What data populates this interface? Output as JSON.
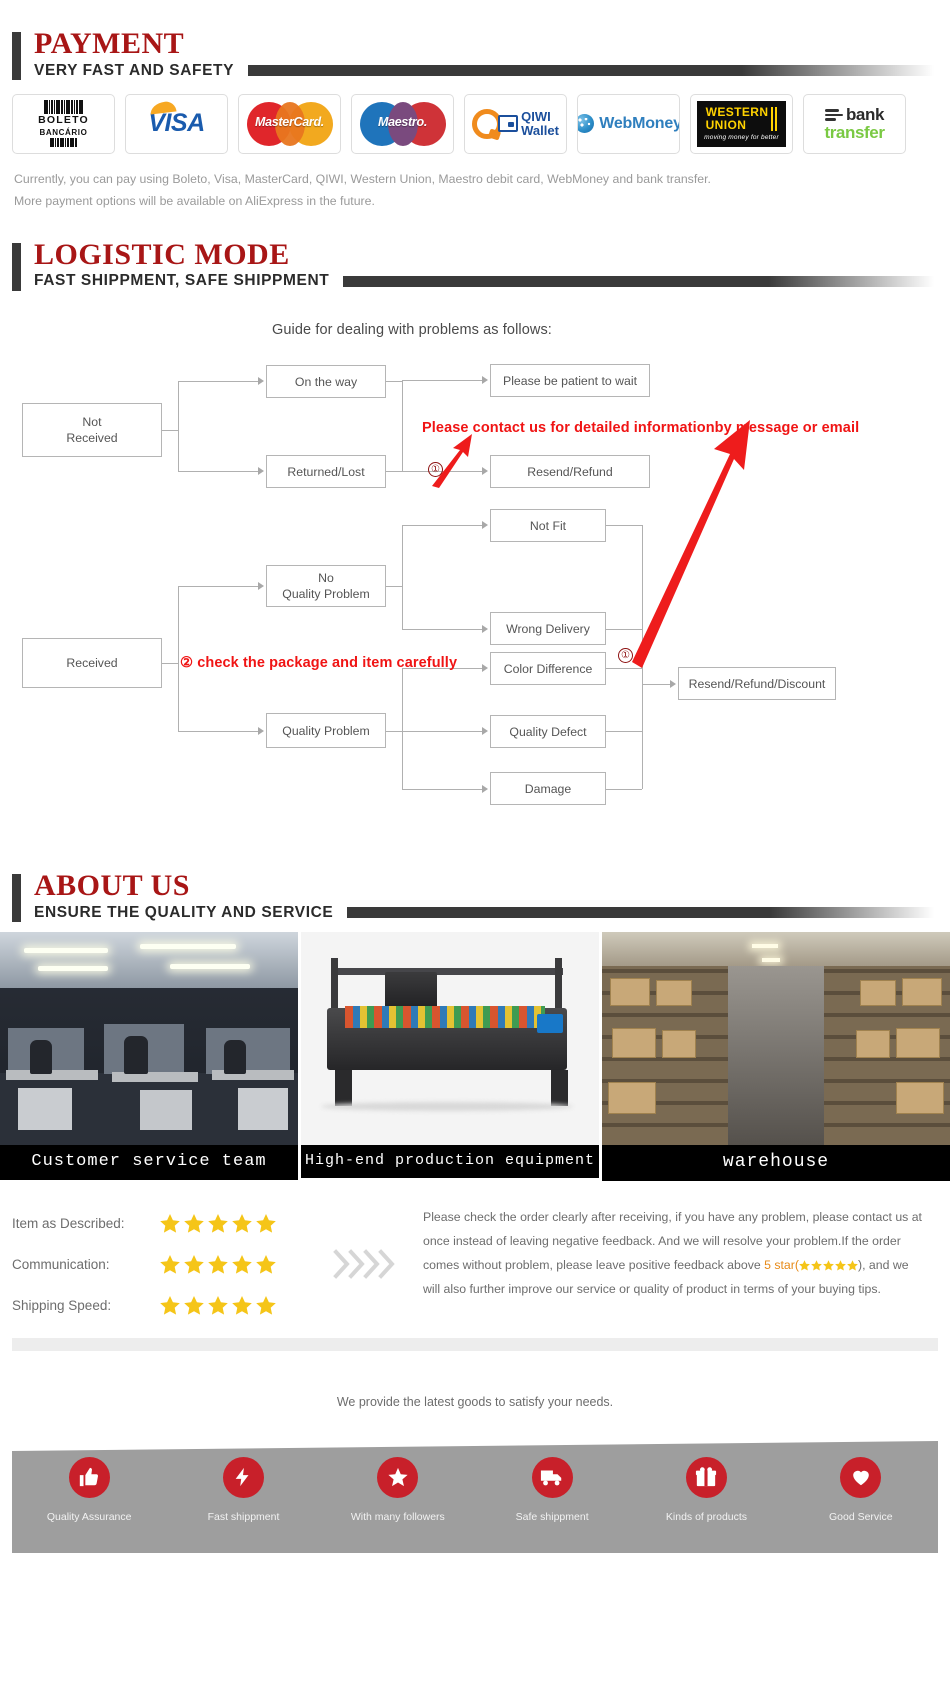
{
  "payment": {
    "title": "PAYMENT",
    "subtitle": "VERY FAST AND SAFETY",
    "methods": [
      {
        "name": "boleto-bancario",
        "line1": "BOLETO",
        "line2": "BANCÁRIO"
      },
      {
        "name": "visa",
        "label": "VISA"
      },
      {
        "name": "mastercard",
        "label": "MasterCard."
      },
      {
        "name": "maestro",
        "label": "Maestro."
      },
      {
        "name": "qiwi-wallet",
        "line1": "QIWI",
        "line2": "Wallet"
      },
      {
        "name": "webmoney",
        "label": "WebMoney"
      },
      {
        "name": "western-union",
        "line1": "WESTERN",
        "line2": "UNION",
        "tagline": "moving money for better"
      },
      {
        "name": "bank-transfer",
        "line1": "bank",
        "line2": "transfer"
      }
    ],
    "note_line1": "Currently, you can pay using Boleto, Visa, MasterCard, QIWI, Western Union, Maestro debit card, WebMoney and bank transfer.",
    "note_line2": "More payment options will be available on AliExpress in the future."
  },
  "logistic": {
    "title": "LOGISTIC MODE",
    "subtitle": "FAST SHIPPMENT, SAFE SHIPPMENT",
    "flow_title": "Guide for dealing with problems as follows:",
    "boxes": {
      "not_received": "Not\nReceived",
      "on_the_way": "On the way",
      "returned_lost": "Returned/Lost",
      "please_wait": "Please be patient to wait",
      "resend_refund": "Resend/Refund",
      "received": "Received",
      "no_quality_problem": "No\nQuality Problem",
      "quality_problem": "Quality Problem",
      "not_fit": "Not Fit",
      "wrong_delivery": "Wrong Delivery",
      "color_difference": "Color Difference",
      "quality_defect": "Quality Defect",
      "damage": "Damage",
      "resend_refund_discount": "Resend/Refund/Discount"
    },
    "annotations": {
      "note1": "Please contact us for detailed informationby message or email",
      "note2": "② check the package and item carefully",
      "marker1": "①",
      "marker2": "①"
    }
  },
  "about": {
    "title": "ABOUT US",
    "subtitle": "ENSURE THE QUALITY AND SERVICE",
    "photos": [
      {
        "name": "customer-service-team",
        "caption": "Customer service team"
      },
      {
        "name": "production-equipment",
        "caption": "High-end production equipment"
      },
      {
        "name": "warehouse",
        "caption": "warehouse"
      }
    ]
  },
  "ratings": {
    "rows": [
      {
        "label": "Item as Described:",
        "stars": 5
      },
      {
        "label": "Communication:",
        "stars": 5
      },
      {
        "label": "Shipping Speed:",
        "stars": 5
      }
    ],
    "feedback_part1": "Please check the order clearly after receiving, if you have any problem, please contact us at once instead of leaving negative feedback. And we will resolve your problem.If the order comes without problem, please leave positive feedback above ",
    "feedback_highlight": "5 star(",
    "feedback_part2": "), and we will also further improve our service or quality of product in terms of your buying tips.",
    "star_color": "#f5c518"
  },
  "tagline": "We provide the latest goods to satisfy your needs.",
  "banner": {
    "accent_color": "#c8202a",
    "items": [
      {
        "icon": "thumbs-up-icon",
        "label": "Quality Assurance"
      },
      {
        "icon": "lightning-bolt-icon",
        "label": "Fast shippment"
      },
      {
        "icon": "star-icon",
        "label": "With many followers"
      },
      {
        "icon": "truck-icon",
        "label": "Safe shippment"
      },
      {
        "icon": "gift-box-icon",
        "label": "Kinds of products"
      },
      {
        "icon": "heart-icon",
        "label": "Good Service"
      }
    ]
  }
}
